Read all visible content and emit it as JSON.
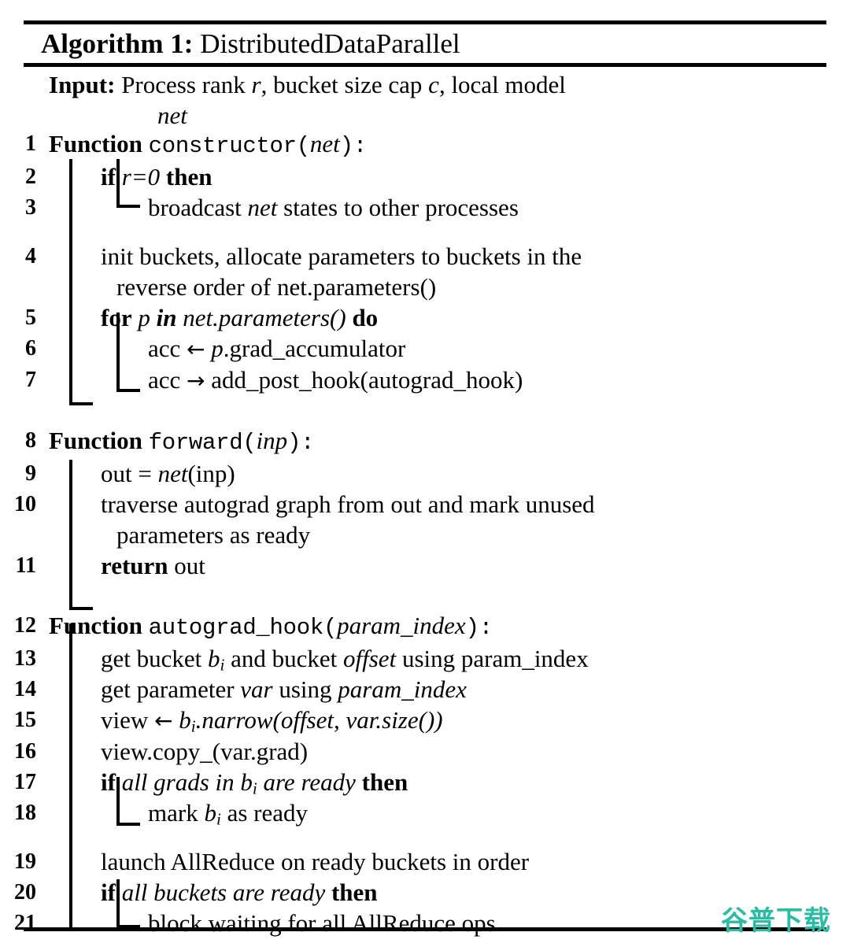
{
  "title": {
    "label": "Algorithm 1:",
    "name": "DistributedDataParallel"
  },
  "input": {
    "label": "Input:",
    "text_before_r": "Process rank ",
    "var_r": "r",
    "text_before_c": ", bucket size cap ",
    "var_c": ", local model",
    "var_c_name": "c",
    "continuation": "net"
  },
  "lines": [
    {
      "n": "1",
      "text": "Function constructor(net):"
    },
    {
      "n": "2",
      "text": "if r=0 then"
    },
    {
      "n": "3",
      "text": "broadcast net states to other processes"
    },
    {
      "n": "4",
      "text": "init buckets, allocate parameters to buckets in the reverse order of net.parameters()"
    },
    {
      "n": "5",
      "text": "for p in net.parameters() do"
    },
    {
      "n": "6",
      "text": "acc ← p.grad_accumulator"
    },
    {
      "n": "7",
      "text": "acc → add_post_hook(autograd_hook)"
    },
    {
      "n": "8",
      "text": "Function forward(inp):"
    },
    {
      "n": "9",
      "text": "out = net(inp)"
    },
    {
      "n": "10",
      "text": "traverse autograd graph from out and mark unused parameters as ready"
    },
    {
      "n": "11",
      "text": "return out"
    },
    {
      "n": "12",
      "text": "Function autograd_hook(param_index):"
    },
    {
      "n": "13",
      "text": "get bucket b_i and bucket offset using param_index"
    },
    {
      "n": "14",
      "text": "get parameter var using param_index"
    },
    {
      "n": "15",
      "text": "view ← b_i.narrow(offset, var.size())"
    },
    {
      "n": "16",
      "text": "view.copy_(var.grad)"
    },
    {
      "n": "17",
      "text": "if all grads in b_i are ready then"
    },
    {
      "n": "18",
      "text": "mark b_i as ready"
    },
    {
      "n": "19",
      "text": "launch AllReduce on ready buckets in order"
    },
    {
      "n": "20",
      "text": "if all buckets are ready then"
    },
    {
      "n": "21",
      "text": "block waiting for all AllReduce ops"
    }
  ],
  "tokens": {
    "kw_function": "Function",
    "kw_if": "if",
    "kw_then": "then",
    "kw_for": "for",
    "kw_in": "in",
    "kw_do": "do",
    "kw_return": "return",
    "fn_constructor": "constructor",
    "fn_forward": "forward",
    "fn_autograd_hook": "autograd_hook",
    "var_net": "net",
    "var_inp": "inp",
    "var_param_index": "param_index",
    "arrow_left": "←",
    "arrow_right": "→",
    "l1_open": "(",
    "l1_close": "):",
    "l2_cond": "r=0",
    "l3_a": "broadcast ",
    "l3_b": "net",
    "l3_c": " states to other processes",
    "l4_a": "init buckets, allocate parameters to buckets in the",
    "l4_b": "reverse order of net.parameters()",
    "l5_p": "p",
    "l5_call": "net.parameters()",
    "l6_a": "acc ",
    "l6_b": "p",
    "l6_c": ".grad_accumulator",
    "l7_a": "acc ",
    "l7_b": "add_post_hook(autograd_hook)",
    "l9_a": "out = ",
    "l9_b": "net",
    "l9_c": "(inp)",
    "l10_a": "traverse autograd graph from out and mark unused",
    "l10_b": "parameters as ready",
    "l11_b": "out",
    "l13_a": "get bucket ",
    "l13_b": "b",
    "l13_sub": "i",
    "l13_c": " and bucket ",
    "l13_d": "offset",
    "l13_e": " using param_index",
    "l14_a": "get parameter ",
    "l14_b": "var",
    "l14_c": " using ",
    "l14_d": "param_index",
    "l15_a": "view ",
    "l15_b": "b",
    "l15_sub": "i",
    "l15_c": ".narrow(",
    "l15_d": "offset, var.size()",
    "l15_e": ")",
    "l16": "view.copy_(var.grad)",
    "l17_a": "all grads in ",
    "l17_b": "b",
    "l17_sub": "i",
    "l17_c": " are ready",
    "l18_a": "mark ",
    "l18_b": "b",
    "l18_sub": "i",
    "l18_c": " as ready",
    "l19": "launch AllReduce on ready buckets in order",
    "l20_cond": "all buckets are ready",
    "l21": "block waiting for all AllReduce ops"
  },
  "watermark": {
    "text": "谷普下载",
    "color": "#2BBCA5"
  }
}
